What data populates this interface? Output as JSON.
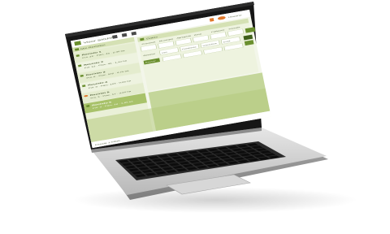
{
  "app": {
    "title": "Visor SIGPAC",
    "user_label": "Usuario"
  },
  "colors": {
    "accent": "#6a8f2e",
    "panel_light": "#eaf0d8",
    "panel_mid": "#d5e1b4",
    "selected": "#a8c26a",
    "user_badge": "#e0782b",
    "screen_bezel": "#141414",
    "laptop_silver": "#c9c9c9"
  },
  "toolbar": {
    "icons": [
      "layers-icon",
      "gear-icon",
      "info-icon"
    ]
  },
  "sidebar": {
    "header": "Mis Recintos",
    "items": [
      {
        "title": "Recinto 1",
        "detail": "Pol. 12 · Parc. 45 · 2,30 ha",
        "state": "normal"
      },
      {
        "title": "Recinto 2",
        "detail": "Pol. 12 · Parc. 46 · 1,10 ha",
        "state": "normal"
      },
      {
        "title": "Recinto 3",
        "detail": "Pol. 8 · Parc. 102 · 4,75 ha",
        "state": "normal"
      },
      {
        "title": "Recinto 4",
        "detail": "Pol. 8 · Parc. 103 · 0,85 ha",
        "state": "normal"
      },
      {
        "title": "Recinto 5",
        "detail": "Pol. 3 · Parc. 17 · 3,20 ha",
        "state": "warning"
      },
      {
        "title": "Recinto 6",
        "detail": "Pol. 3 · Parc. 18 · 1,95 ha",
        "state": "selected"
      }
    ]
  },
  "query_panel": {
    "header": "Datos",
    "column_headers": [
      "Provincia",
      "Municipio",
      "Agregado",
      "Zona",
      "Polígono",
      "Parcela"
    ],
    "row_label": "Recinto",
    "search_label": "Buscar",
    "filter_labels": [
      "Uso",
      "Pendiente",
      "Superficie",
      "Coef."
    ]
  },
  "status_bar": {
    "text": "Escala 1:5000"
  }
}
